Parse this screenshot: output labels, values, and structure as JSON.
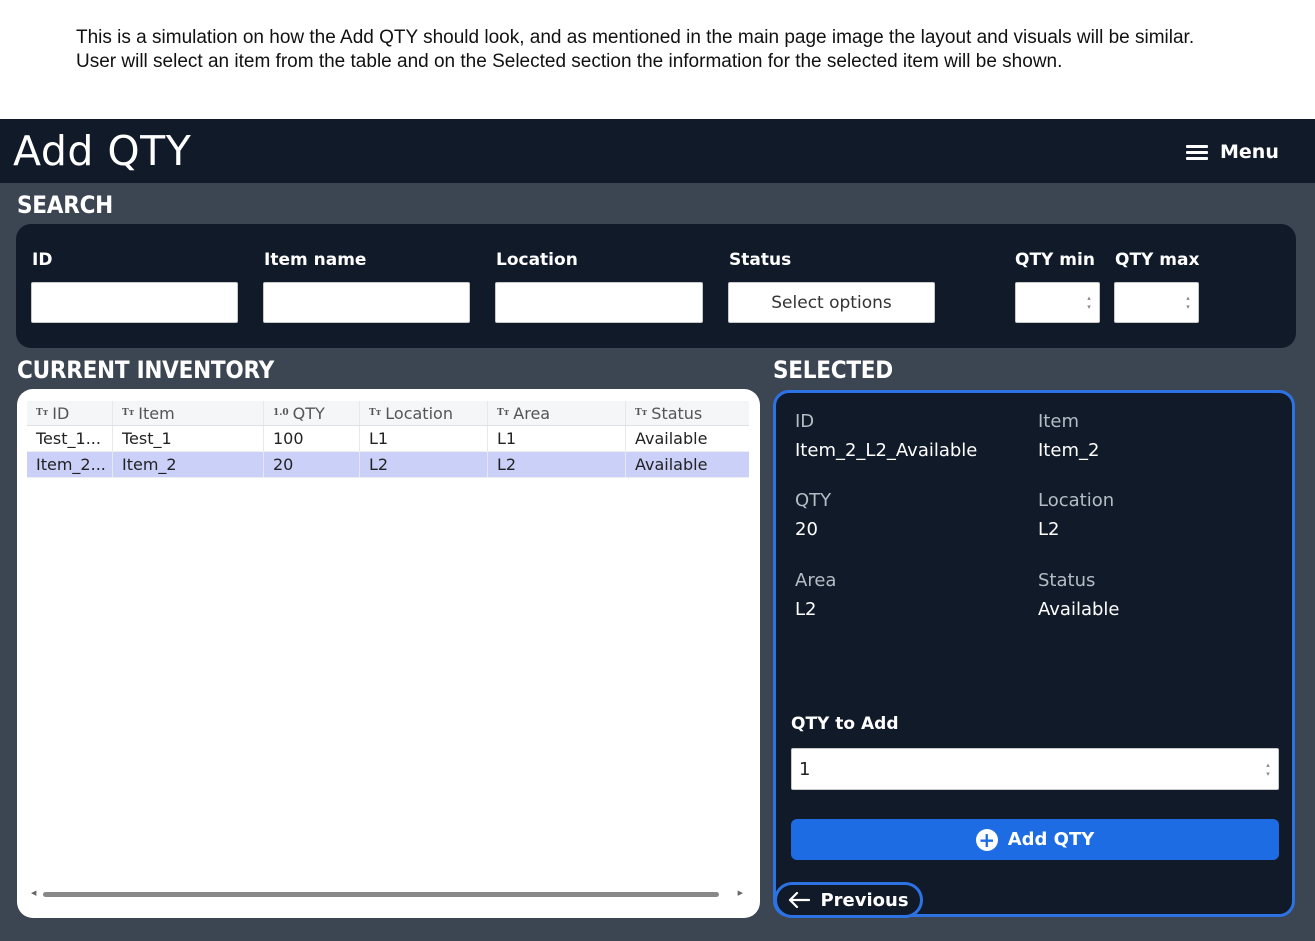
{
  "intro_text": "This is a simulation on how the Add QTY should look, and as mentioned in the main page image the layout and visuals will be similar. User will select an item from the table and on the Selected section the information for the selected item will be shown.",
  "header": {
    "title": "Add QTY",
    "menu_label": "Menu"
  },
  "search": {
    "heading": "SEARCH",
    "id_label": "ID",
    "id_value": "",
    "item_name_label": "Item name",
    "item_name_value": "",
    "location_label": "Location",
    "location_value": "",
    "status_label": "Status",
    "status_select": "Select options",
    "qty_min_label": "QTY min",
    "qty_max_label": "QTY max"
  },
  "inventory": {
    "heading": "CURRENT INVENTORY",
    "columns": [
      {
        "label": "ID",
        "type_icon": "Tт"
      },
      {
        "label": "Item",
        "type_icon": "Tт"
      },
      {
        "label": "QTY",
        "type_icon": "1.0"
      },
      {
        "label": "Location",
        "type_icon": "Tт"
      },
      {
        "label": "Area",
        "type_icon": "Tт"
      },
      {
        "label": "Status",
        "type_icon": "Tт"
      }
    ],
    "rows": [
      {
        "id": "Test_1...",
        "item": "Test_1",
        "qty": "100",
        "location": "L1",
        "area": "L1",
        "status": "Available",
        "selected": false
      },
      {
        "id": "Item_2...",
        "item": "Item_2",
        "qty": "20",
        "location": "L2",
        "area": "L2",
        "status": "Available",
        "selected": true
      }
    ]
  },
  "selected": {
    "heading": "SELECTED",
    "id_label": "ID",
    "id_value": "Item_2_L2_Available",
    "item_label": "Item",
    "item_value": "Item_2",
    "qty_label": "QTY",
    "qty_value": "20",
    "location_label": "Location",
    "location_value": "L2",
    "area_label": "Area",
    "area_value": "L2",
    "status_label": "Status",
    "status_value": "Available",
    "qty_to_add_label": "QTY to Add",
    "qty_to_add_value": "1",
    "add_button": "Add QTY",
    "previous_button": "Previous"
  },
  "colors": {
    "topbar": "#111a29",
    "background": "#3c4652",
    "accent": "#2d72e3",
    "selected_row": "#cbd0f9"
  }
}
